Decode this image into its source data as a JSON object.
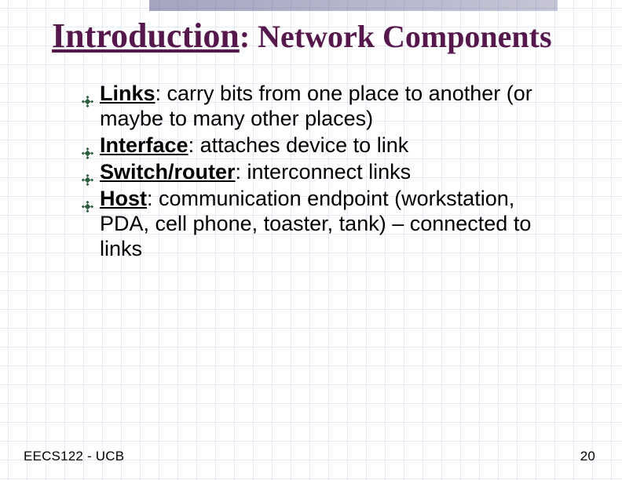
{
  "title": {
    "underlined": "Introduction",
    "rest": ": Network Components"
  },
  "bullets": [
    {
      "term": "Links",
      "text": ": carry bits from one place to another (or maybe to many other places)"
    },
    {
      "term": "Interface",
      "text": ": attaches device to link"
    },
    {
      "term": "Switch/router",
      "text": ": interconnect links"
    },
    {
      "term": "Host",
      "text": ": communication endpoint (workstation, PDA, cell phone, toaster, tank) – connected to links"
    }
  ],
  "footer": {
    "left": "EECS122 - UCB",
    "right": "20"
  },
  "icons": {
    "bullet": "diamond-bullet-icon"
  }
}
